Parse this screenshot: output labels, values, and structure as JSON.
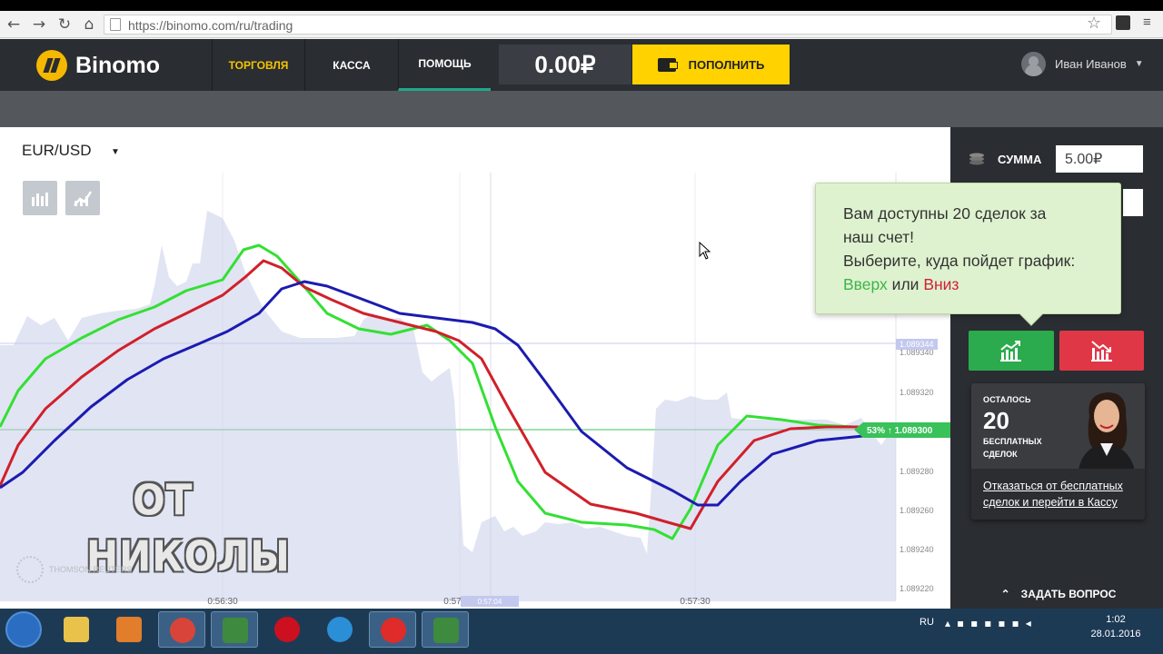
{
  "browser": {
    "url": "https://binomo.com/ru/trading"
  },
  "app": {
    "logo_text": "Binomo",
    "tabs": [
      {
        "label": "ТОРГОВЛЯ"
      },
      {
        "label": "КАССА"
      },
      {
        "label": "ПОМОЩЬ"
      }
    ],
    "balance": "0.00₽",
    "deposit_label": "ПОПОЛНИТЬ",
    "user_name": "Иван Иванов"
  },
  "chart_header": {
    "pair": "EUR/USD"
  },
  "chart": {
    "price_ticks": [
      "1.089340",
      "1.089320",
      "1.089280",
      "1.089260",
      "1.089240",
      "1.089220"
    ],
    "time_ticks": [
      "0:56:30",
      "0:57",
      "0:57:30"
    ],
    "cursor_time": "0:57:04",
    "current_price_label": "53% ↑ 1.089300",
    "marker_price": "1.089344",
    "colors": {
      "green": "#33e033",
      "red": "#d0202a",
      "blue": "#1b1bb0",
      "area": "#c9cdea"
    }
  },
  "side": {
    "sum_label": "СУММА",
    "sum_value": "5.00₽"
  },
  "tooltip": {
    "line1": "Вам доступны 20 сделок за",
    "line2": "наш счет!",
    "line3": "Выберите, куда пойдет график:",
    "up_word": "Вверх",
    "or_word": "или",
    "down_word": "Вниз"
  },
  "promo": {
    "left_label": "ОСТАЛОСЬ",
    "count": "20",
    "free_label": "БЕСПЛАТНЫХ СДЕЛОК",
    "link": "Отказаться от бесплатных сделок и перейти в Кассу"
  },
  "ask_label": "ЗАДАТЬ ВОПРОС",
  "watermark": {
    "line1": "ОТ",
    "line2": "НИКОЛЫ",
    "provider": "THOMSON REUTERS"
  },
  "taskbar": {
    "lang": "RU",
    "time": "1:02",
    "date": "28.01.2016"
  }
}
